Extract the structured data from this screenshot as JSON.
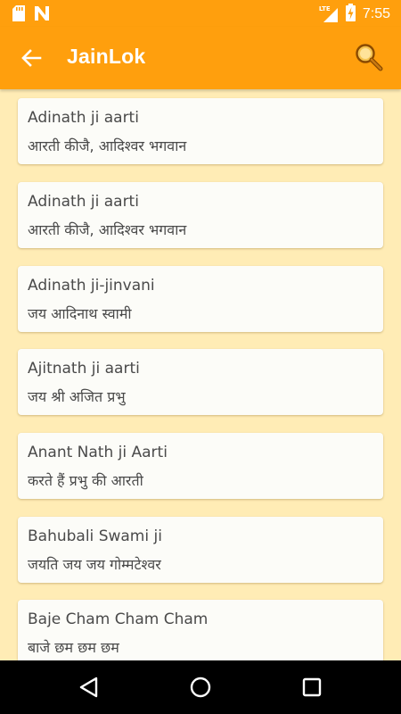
{
  "status_bar": {
    "time": "7:55",
    "network_label": "LTE",
    "icons": [
      "sd-card-icon",
      "n-notification-icon",
      "signal-icon",
      "battery-charging-icon"
    ]
  },
  "app_bar": {
    "title": "JainLok",
    "back_icon": "arrow-back-icon",
    "search_icon": "magnifier-icon"
  },
  "colors": {
    "primary": "#FF9F0D",
    "background": "#FFECB5",
    "card": "#FCFCF8",
    "text": "#4A4A4A"
  },
  "list": {
    "items": [
      {
        "title": "Adinath ji aarti",
        "subtitle": "आरती कीजै, आदिश्वर भगवान"
      },
      {
        "title": "Adinath ji aarti",
        "subtitle": "आरती कीजै, आदिश्वर भगवान"
      },
      {
        "title": "Adinath ji-jinvani",
        "subtitle": "जय आदिनाथ स्वामी"
      },
      {
        "title": "Ajitnath ji aarti",
        "subtitle": "जय श्री अजित प्रभु"
      },
      {
        "title": "Anant Nath ji Aarti",
        "subtitle": "करते हैं प्रभु की आरती"
      },
      {
        "title": "Bahubali Swami ji",
        "subtitle": "जयति जय जय गोम्मटेश्वर"
      },
      {
        "title": "Baje Cham Cham Cham",
        "subtitle": "बाजे छम छम छम"
      }
    ]
  },
  "nav_bar": {
    "icons": [
      "back-triangle-icon",
      "home-circle-icon",
      "recents-square-icon"
    ]
  }
}
